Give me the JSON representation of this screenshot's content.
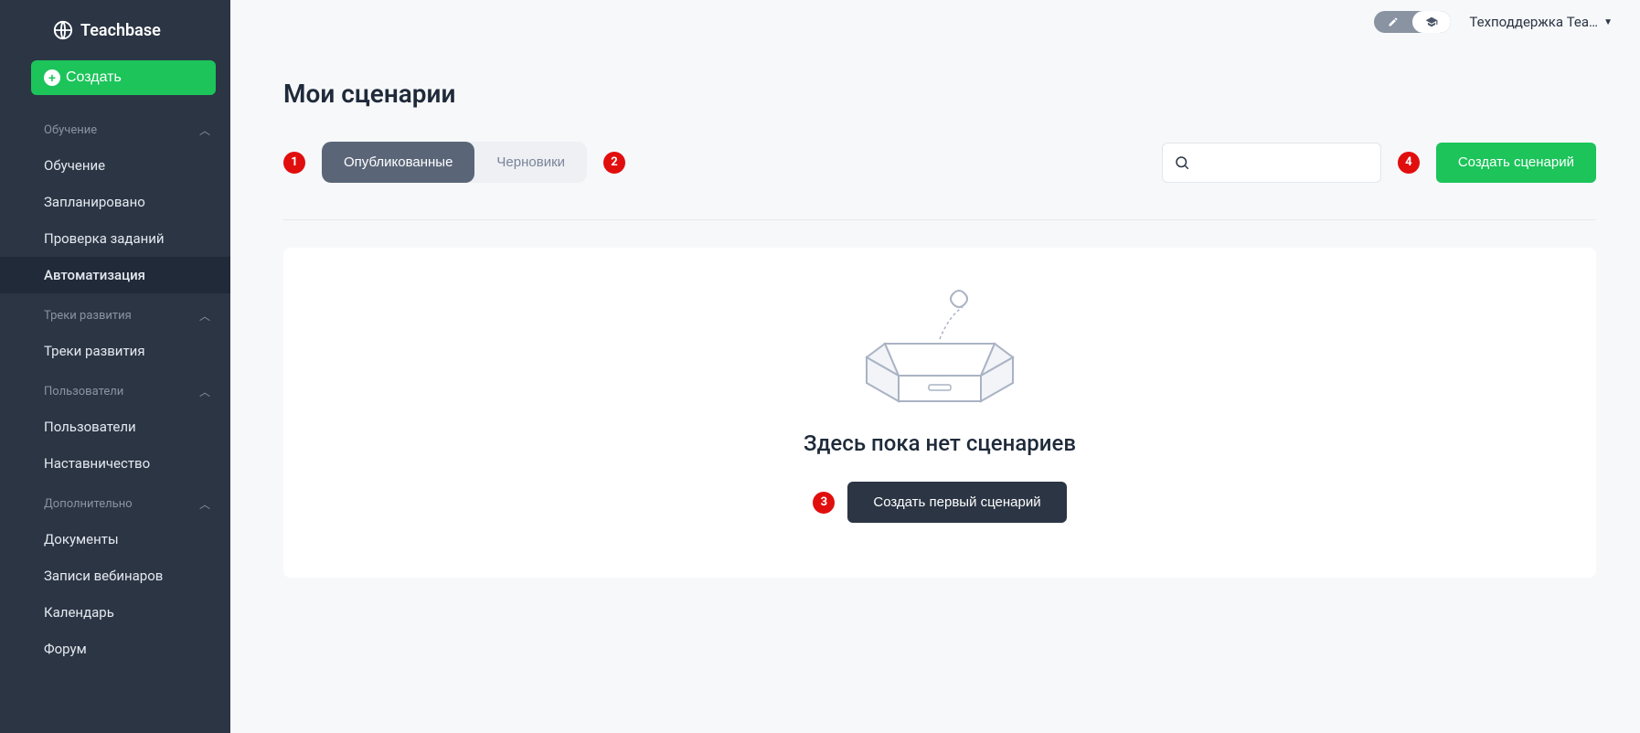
{
  "brand": "Teachbase",
  "create_label": "Создать",
  "sidebar": {
    "sections": [
      {
        "title": "Обучение",
        "items": [
          "Обучение",
          "Запланировано",
          "Проверка заданий",
          "Автоматизация"
        ],
        "active_index": 3
      },
      {
        "title": "Треки развития",
        "items": [
          "Треки развития"
        ]
      },
      {
        "title": "Пользователи",
        "items": [
          "Пользователи",
          "Наставничество"
        ]
      },
      {
        "title": "Дополнительно",
        "items": [
          "Документы",
          "Записи вебинаров",
          "Календарь",
          "Форум"
        ]
      }
    ]
  },
  "topbar": {
    "user_label": "Техподдержка Tea…"
  },
  "page": {
    "title": "Мои сценарии",
    "tabs": [
      "Опубликованные",
      "Черновики"
    ],
    "active_tab": 0,
    "search_placeholder": "",
    "create_scenario": "Создать сценарий",
    "empty_title": "Здесь пока нет сценариев",
    "empty_button": "Создать первый сценарий"
  },
  "annotations": [
    "1",
    "2",
    "3",
    "4"
  ]
}
